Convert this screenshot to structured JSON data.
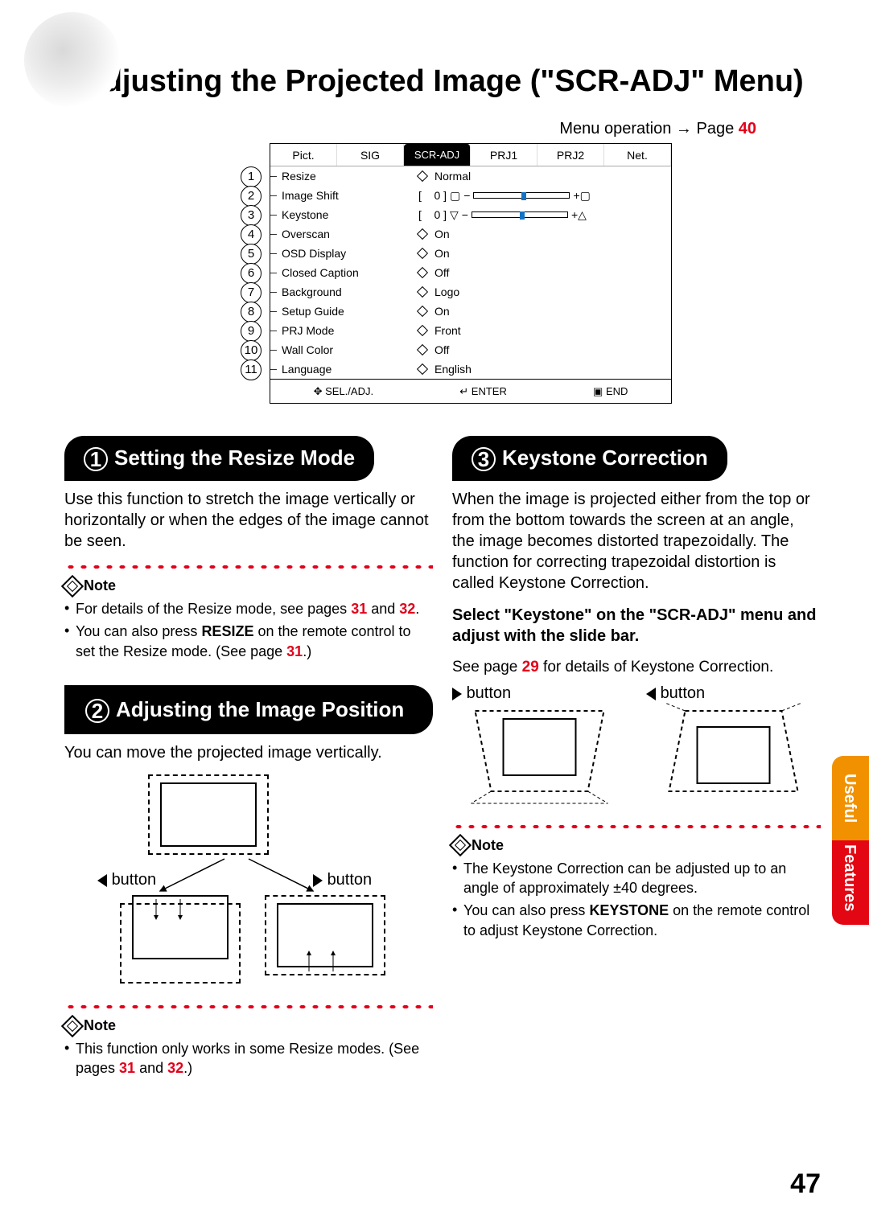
{
  "page": {
    "title": "Adjusting the Projected Image (\"SCR-ADJ\" Menu)",
    "number": "47"
  },
  "menu_operation": {
    "prefix": "Menu operation ",
    "arrow": "→",
    "page_label": " Page ",
    "page_ref": "40"
  },
  "osd": {
    "tabs": [
      "Pict.",
      "SIG",
      "SCR-ADJ",
      "PRJ1",
      "PRJ2",
      "Net."
    ],
    "active_tab": 2,
    "rows": [
      {
        "n": "1",
        "name": "Resize",
        "type": "enum",
        "val": "Normal"
      },
      {
        "n": "2",
        "name": "Image Shift",
        "type": "slider",
        "left": "[",
        "num": "0",
        "val": "0",
        "minus": "−",
        "plus": "+"
      },
      {
        "n": "3",
        "name": "Keystone",
        "type": "slider",
        "left": "[",
        "num": "0",
        "val": "0",
        "minus": "−",
        "plus": "+"
      },
      {
        "n": "4",
        "name": "Overscan",
        "type": "enum",
        "val": "On"
      },
      {
        "n": "5",
        "name": "OSD Display",
        "type": "enum",
        "val": "On"
      },
      {
        "n": "6",
        "name": "Closed Caption",
        "type": "enum",
        "val": "Off"
      },
      {
        "n": "7",
        "name": "Background",
        "type": "enum",
        "val": "Logo"
      },
      {
        "n": "8",
        "name": "Setup Guide",
        "type": "enum",
        "val": "On"
      },
      {
        "n": "9",
        "name": "PRJ Mode",
        "type": "enum",
        "val": "Front"
      },
      {
        "n": "10",
        "name": "Wall Color",
        "type": "enum",
        "val": "Off"
      },
      {
        "n": "11",
        "name": "Language",
        "type": "enum",
        "val": "English"
      }
    ],
    "footer": {
      "sel": "SEL./ADJ.",
      "enter": "ENTER",
      "end": "END"
    }
  },
  "sections": {
    "s1": {
      "num": "1",
      "title": "Setting the Resize Mode",
      "body": "Use this function to stretch the image vertically or horizontally or when the edges of the image cannot be seen.",
      "note_label": "Note",
      "note_item1_pre": "For details of the Resize mode, see pages ",
      "note_item1_ref1": "31",
      "note_item1_mid": " and ",
      "note_item1_ref2": "32",
      "note_item1_post": ".",
      "note_item2_pre": "You can also press ",
      "note_item2_bold": "RESIZE",
      "note_item2_mid": " on the remote control to set the Resize mode. (See page ",
      "note_item2_ref": "31",
      "note_item2_post": ".)"
    },
    "s2": {
      "num": "2",
      "title": "Adjusting the Image Position",
      "body": "You can move the projected image vertically.",
      "btn_left": "button",
      "btn_right": "button",
      "note_label": "Note",
      "note_item1_pre": "This function only works in some Resize modes. (See pages ",
      "note_item1_ref1": "31",
      "note_item1_mid": " and ",
      "note_item1_ref2": "32",
      "note_item1_post": ".)"
    },
    "s3": {
      "num": "3",
      "title": "Keystone Correction",
      "body": "When the image is projected either from the top or from the bottom towards the screen at an angle, the image becomes distorted trapezoidally. The function for correcting trapezoidal distortion is called Keystone Correction.",
      "instruct": "Select \"Keystone\" on the \"SCR-ADJ\" menu and adjust with the slide bar.",
      "see_pre": "See page ",
      "see_ref": "29",
      "see_post": " for details of Keystone Correction.",
      "btn_right": "button",
      "btn_left": "button",
      "note_label": "Note",
      "note_item1": "The Keystone Correction can be adjusted up to an angle of approximately ±40 degrees.",
      "note_item2_pre": "You can also press ",
      "note_item2_bold": "KEYSTONE",
      "note_item2_post": " on the remote control to adjust Keystone Correction."
    }
  },
  "sidetab": {
    "line1": "Useful",
    "line2": "Features"
  }
}
